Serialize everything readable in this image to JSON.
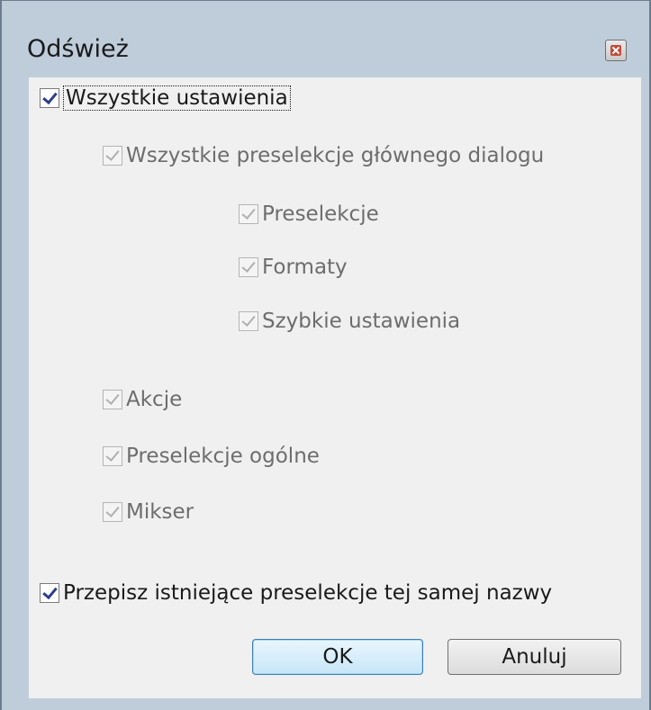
{
  "dialog": {
    "title": "Odśwież"
  },
  "options": {
    "all_settings": {
      "label": "Wszystkie ustawienia",
      "checked": true,
      "enabled": true
    },
    "main_dialog_presets": {
      "label": "Wszystkie preselekcje głównego dialogu",
      "checked": true,
      "enabled": false
    },
    "presets": {
      "label": "Preselekcje",
      "checked": true,
      "enabled": false
    },
    "formats": {
      "label": "Formaty",
      "checked": true,
      "enabled": false
    },
    "quick_settings": {
      "label": "Szybkie ustawienia",
      "checked": true,
      "enabled": false
    },
    "actions": {
      "label": "Akcje",
      "checked": true,
      "enabled": false
    },
    "general_presets": {
      "label": "Preselekcje ogólne",
      "checked": true,
      "enabled": false
    },
    "mixer": {
      "label": "Mikser",
      "checked": true,
      "enabled": false
    },
    "overwrite": {
      "label": "Przepisz istniejące preselekcje tej samej nazwy",
      "checked": true,
      "enabled": true
    }
  },
  "buttons": {
    "ok": "OK",
    "cancel": "Anuluj"
  }
}
